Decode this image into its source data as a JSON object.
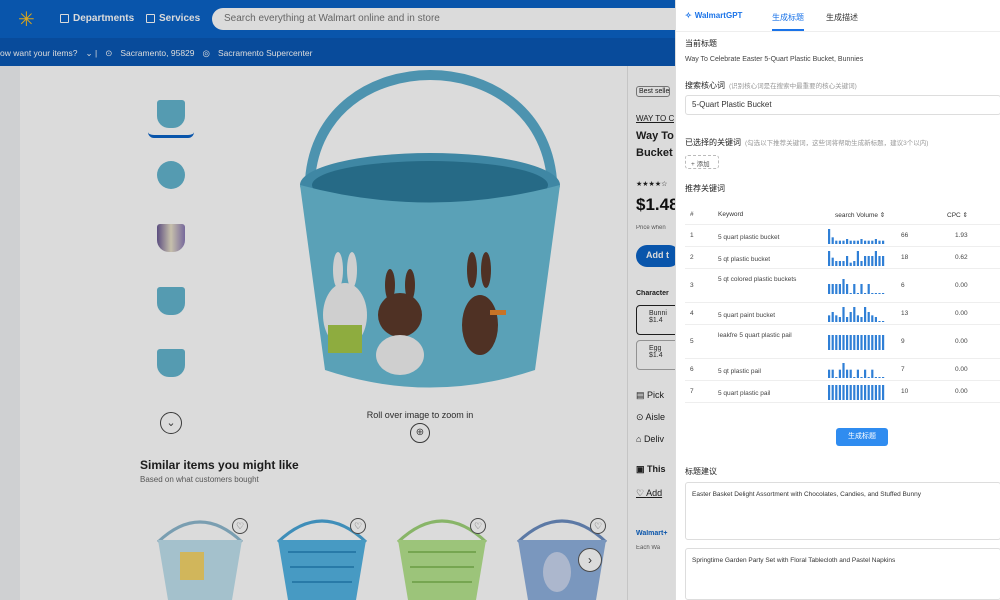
{
  "walmart": {
    "departments_label": "Departments",
    "services_label": "Services",
    "search_placeholder": "Search everything at Walmart online and in store",
    "delivery_question": "ow want your items?",
    "location": "Sacramento, 95829",
    "store": "Sacramento Supercenter",
    "zoom_text": "Roll over image to zoom in",
    "similar_title": "Similar items you might like",
    "similar_subtitle": "Based on what customers bought",
    "right_snippets": {
      "badge": "Best selle",
      "brand": "WAY TO C",
      "title_1": "Way To",
      "title_2": "Bucket",
      "price": "$1.48",
      "price_when": "Price when",
      "add_button": "Add t",
      "character": "Character",
      "opt1_1": "Bunni",
      "opt1_2": "$1.4",
      "opt2_1": "Egg",
      "opt2_2": "$1.4",
      "pickup": "Pick",
      "aisle": "Aisle",
      "delivery": "Deliv",
      "this": "This",
      "add": "Add",
      "walmart_plus": "Walmart+",
      "plus_sub": "Each Wa"
    }
  },
  "panel": {
    "logo": "WalmartGPT",
    "tabs": [
      "生成标题",
      "生成描述"
    ],
    "current_title_label": "当前标题",
    "current_title": "Way To Celebrate Easter 5-Quart Plastic Bucket, Bunnies",
    "core_kw_label": "搜索核心词",
    "core_kw_hint": "(识别核心词是在搜索中最重要的核心关键词)",
    "core_kw_value": "5-Quart Plastic Bucket",
    "selected_kw_label": "已选择的关键词",
    "selected_kw_hint": "(勾选以下推荐关键词，这些词将帮助生成新标题，建议3个以内)",
    "add_label": "+ 添加",
    "recommended_label": "推荐关键词",
    "table_headers": {
      "idx": "#",
      "keyword": "Keyword",
      "volume": "search Volume ⇕",
      "cpc": "CPC ⇕"
    },
    "rows": [
      {
        "idx": "1",
        "keyword": "5 quart plastic bucket",
        "volume": "66",
        "cpc": "1.93",
        "spark": [
          9,
          4,
          2,
          2,
          2,
          3,
          2,
          2,
          2,
          3,
          2,
          2,
          2,
          3,
          2,
          2
        ]
      },
      {
        "idx": "2",
        "keyword": "5 qt plastic bucket",
        "volume": "18",
        "cpc": "0.62",
        "spark": [
          9,
          5,
          3,
          3,
          3,
          6,
          2,
          3,
          9,
          3,
          6,
          6,
          6,
          9,
          6,
          6
        ]
      },
      {
        "idx": "3",
        "keyword": "5 qt colored plastic buckets",
        "volume": "6",
        "cpc": "0.00",
        "spark": [
          6,
          6,
          6,
          6,
          9,
          6,
          0,
          6,
          0,
          6,
          0,
          6,
          0,
          0,
          0,
          0
        ]
      },
      {
        "idx": "4",
        "keyword": "5 quart paint bucket",
        "volume": "13",
        "cpc": "0.00",
        "spark": [
          4,
          6,
          4,
          3,
          9,
          3,
          6,
          9,
          4,
          3,
          9,
          6,
          4,
          3,
          0,
          0
        ]
      },
      {
        "idx": "5",
        "keyword": "leakfre 5 quart plastic pail",
        "volume": "9",
        "cpc": "0.00",
        "spark": [
          9,
          9,
          9,
          9,
          9,
          9,
          9,
          9,
          9,
          9,
          9,
          9,
          9,
          9,
          9,
          9
        ]
      },
      {
        "idx": "6",
        "keyword": "5 qt plastic pail",
        "volume": "7",
        "cpc": "0.00",
        "spark": [
          5,
          5,
          0,
          5,
          9,
          5,
          5,
          0,
          5,
          0,
          5,
          0,
          5,
          0,
          0,
          0
        ]
      },
      {
        "idx": "7",
        "keyword": "5 quart plastic pail",
        "volume": "10",
        "cpc": "0.00",
        "spark": [
          9,
          9,
          9,
          9,
          9,
          9,
          9,
          9,
          9,
          9,
          9,
          9,
          9,
          9,
          9,
          9
        ]
      }
    ],
    "generate_button": "生成标题",
    "suggestions_label": "标题建议",
    "suggestions": [
      "Easter Basket Delight Assortment with Chocolates, Candies, and Stuffed Bunny",
      "Springtime Garden Party Set with Floral Tablecloth and Pastel Napkins"
    ]
  }
}
